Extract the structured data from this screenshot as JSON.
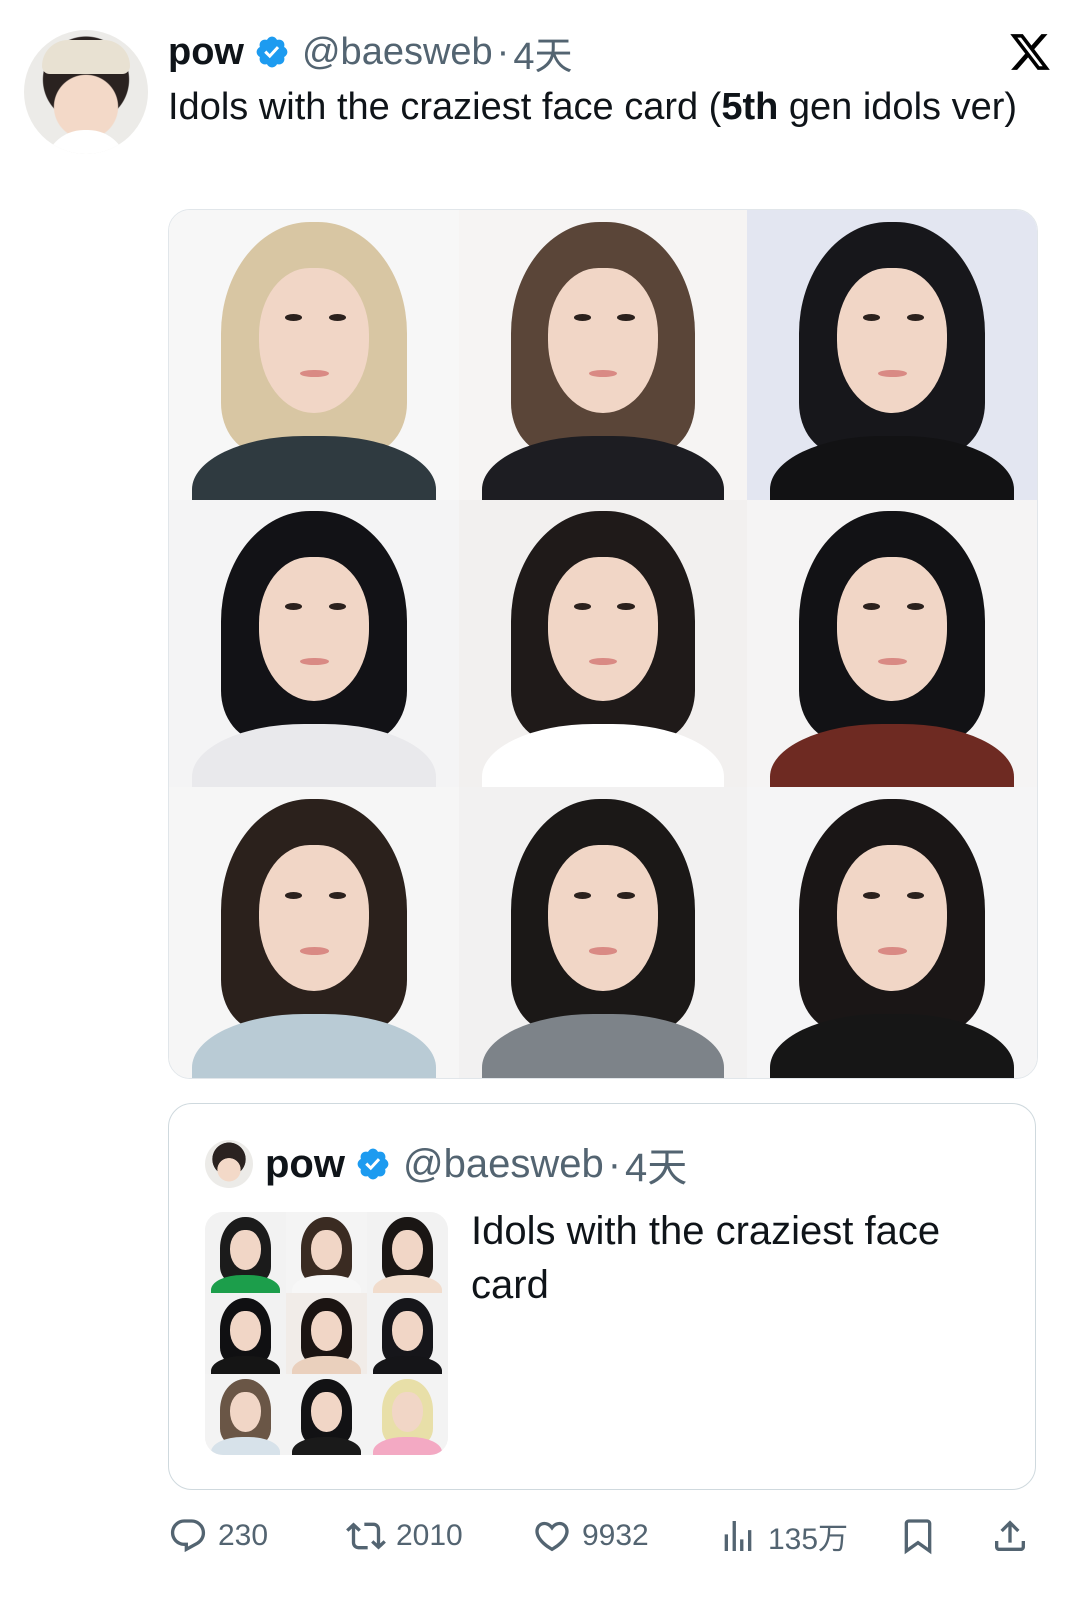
{
  "author": {
    "display_name": "pow",
    "handle": "@baesweb",
    "separator": "·",
    "time": "4天",
    "avatar_icon": "user-avatar"
  },
  "tweet": {
    "text_before_bold": "Idols with the craziest face card (",
    "text_bold": "5th",
    "text_after_bold": " gen idols ver)"
  },
  "photos": [
    {
      "name": "photo-1",
      "bg": "#f7f7f7",
      "hair": "#d8c6a3",
      "body": "#2f3a40"
    },
    {
      "name": "photo-2",
      "bg": "#f6f4f3",
      "hair": "#5a4538",
      "body": "#1d1d22"
    },
    {
      "name": "photo-3",
      "bg": "#e3e6f1",
      "hair": "#17171b",
      "body": "#121214"
    },
    {
      "name": "photo-4",
      "bg": "#f4f4f5",
      "hair": "#121216",
      "body": "#e9e9ec"
    },
    {
      "name": "photo-5",
      "bg": "#f2f0ef",
      "hair": "#1f1a19",
      "body": "#ffffff"
    },
    {
      "name": "photo-6",
      "bg": "#f5f4f4",
      "hair": "#121215",
      "body": "#6e2a22"
    },
    {
      "name": "photo-7",
      "bg": "#f6f6f6",
      "hair": "#2b211c",
      "body": "#b9cbd5"
    },
    {
      "name": "photo-8",
      "bg": "#f2f1f1",
      "hair": "#1b1817",
      "body": "#7d8389"
    },
    {
      "name": "photo-9",
      "bg": "#f5f5f6",
      "hair": "#1a1616",
      "body": "#161616"
    }
  ],
  "quote": {
    "display_name": "pow",
    "handle": "@baesweb",
    "separator": "·",
    "time": "4天",
    "text": "Idols with the craziest face card",
    "thumbs": [
      {
        "bg": "#f2f2f2",
        "hair": "#1b1b1b",
        "body": "#1c9e4b"
      },
      {
        "bg": "#f4f4f4",
        "hair": "#3a2b22",
        "body": "#f7f7f7"
      },
      {
        "bg": "#f2f2f2",
        "hair": "#1a1614",
        "body": "#f1dccc"
      },
      {
        "bg": "#f2f2f2",
        "hair": "#101012",
        "body": "#151515"
      },
      {
        "bg": "#f1ece8",
        "hair": "#1b1412",
        "body": "#ead0bd"
      },
      {
        "bg": "#f2f2f2",
        "hair": "#16161a",
        "body": "#151518"
      },
      {
        "bg": "#f3f3f3",
        "hair": "#6a5646",
        "body": "#d7e2ea"
      },
      {
        "bg": "#f3f3f3",
        "hair": "#121214",
        "body": "#1a1a1a"
      },
      {
        "bg": "#f3f3f3",
        "hair": "#e8dfa8",
        "body": "#f3a9c3"
      }
    ]
  },
  "actions": {
    "replies": "230",
    "retweets": "2010",
    "likes": "9932",
    "views": "135万"
  },
  "colors": {
    "verified": "#1d9bf0",
    "muted": "#536471",
    "text": "#0f1419"
  }
}
